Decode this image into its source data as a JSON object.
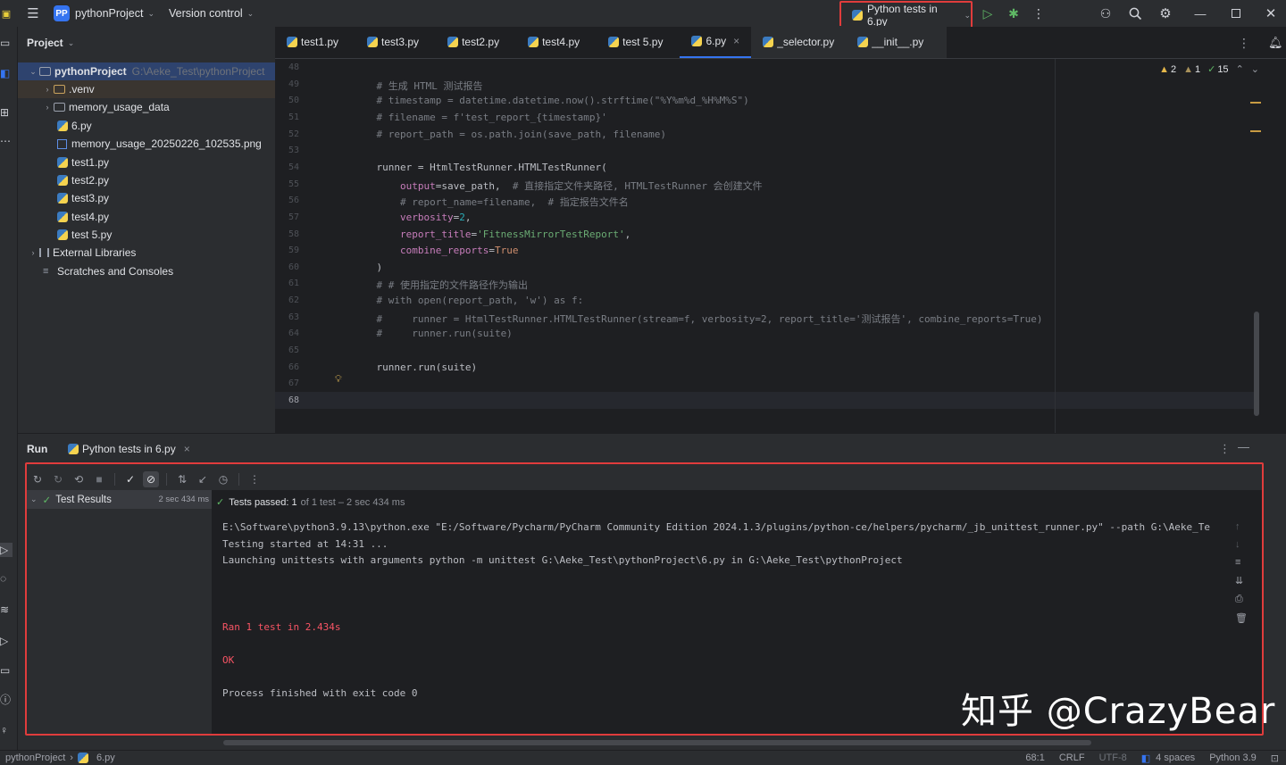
{
  "titlebar": {
    "project_badge": "PP",
    "project_name": "pythonProject",
    "vcs_menu": "Version control",
    "run_config": "Python tests in 6.py",
    "icons": [
      "hamburger-menu-icon",
      "run-icon",
      "debug-icon",
      "more-icon",
      "add-user-icon",
      "search-icon",
      "settings-icon",
      "minimize-icon",
      "maximize-icon",
      "close-icon"
    ]
  },
  "project_panel": {
    "title": "Project",
    "root": {
      "name": "pythonProject",
      "path": "G:\\Aeke_Test\\pythonProject"
    },
    "items": [
      {
        "label": ".venv",
        "type": "folder",
        "expandable": true
      },
      {
        "label": "memory_usage_data",
        "type": "folder",
        "expandable": true
      },
      {
        "label": "6.py",
        "type": "python"
      },
      {
        "label": "memory_usage_20250226_102535.png",
        "type": "image"
      },
      {
        "label": "test1.py",
        "type": "python"
      },
      {
        "label": "test2.py",
        "type": "python"
      },
      {
        "label": "test3.py",
        "type": "python"
      },
      {
        "label": "test4.py",
        "type": "python"
      },
      {
        "label": "test 5.py",
        "type": "python"
      }
    ],
    "external_libraries": "External Libraries",
    "scratches": "Scratches and Consoles"
  },
  "tabs": [
    {
      "label": "test1.py"
    },
    {
      "label": "test3.py"
    },
    {
      "label": "test2.py"
    },
    {
      "label": "test4.py"
    },
    {
      "label": "test 5.py"
    },
    {
      "label": "6.py",
      "active": true
    },
    {
      "label": "_selector.py"
    },
    {
      "label": "__init__.py"
    }
  ],
  "inspections": {
    "warnings": "2",
    "weak_warnings": "1",
    "ok": "15"
  },
  "editor": {
    "line_numbers": [
      "48",
      "49",
      "50",
      "51",
      "52",
      "53",
      "54",
      "55",
      "56",
      "57",
      "58",
      "59",
      "60",
      "61",
      "62",
      "63",
      "64",
      "65",
      "66",
      "67",
      "68"
    ],
    "lines": [
      "",
      "    # 生成 HTML 测试报告",
      "    # timestamp = datetime.datetime.now().strftime(\"%Y%m%d_%H%M%S\")",
      "    # filename = f'test_report_{timestamp}'",
      "    # report_path = os.path.join(save_path, filename)",
      "",
      "    runner = HtmlTestRunner.HTMLTestRunner(",
      "        output=save_path,  # 直接指定文件夹路径, HTMLTestRunner 会创建文件",
      "        # report_name=filename,  # 指定报告文件名",
      "        verbosity=2,",
      "        report_title='FitnessMirrorTestReport',",
      "        combine_reports=True",
      "    )",
      "    # # 使用指定的文件路径作为输出",
      "    # with open(report_path, 'w') as f:",
      "    #     runner = HtmlTestRunner.HTMLTestRunner(stream=f, verbosity=2, report_title='测试报告', combine_reports=True)",
      "    #     runner.run(suite)",
      "",
      "    runner.run(suite)",
      "",
      ""
    ]
  },
  "run_panel": {
    "title": "Run",
    "tab_label": "Python tests in 6.py",
    "test_results_label": "Test Results",
    "test_results_time": "2 sec 434 ms",
    "passed_label": "Tests passed: 1",
    "passed_detail": "of 1 test – 2 sec 434 ms",
    "output": [
      "E:\\Software\\python3.9.13\\python.exe \"E:/Software/Pycharm/PyCharm Community Edition 2024.1.3/plugins/python-ce/helpers/pycharm/_jb_unittest_runner.py\" --path G:\\Aeke_Te",
      "Testing started at 14:31 ...",
      "Launching unittests with arguments python -m unittest G:\\Aeke_Test\\pythonProject\\6.py in G:\\Aeke_Test\\pythonProject"
    ],
    "ran_line": "Ran 1 test in 2.434s",
    "ok_line": "OK",
    "exit_line": "Process finished with exit code 0"
  },
  "watermark": "知乎 @CrazyBear",
  "status_bar": {
    "project": "pythonProject",
    "file": "6.py",
    "position": "68:1",
    "line_sep": "CRLF",
    "encoding": "UTF-8",
    "indent": "4 spaces",
    "interpreter": "Python 3.9"
  },
  "colors": {
    "accent": "#3574f0",
    "highlight_box": "#e03c3c",
    "error_text": "#f75464",
    "success": "#5fb865"
  }
}
